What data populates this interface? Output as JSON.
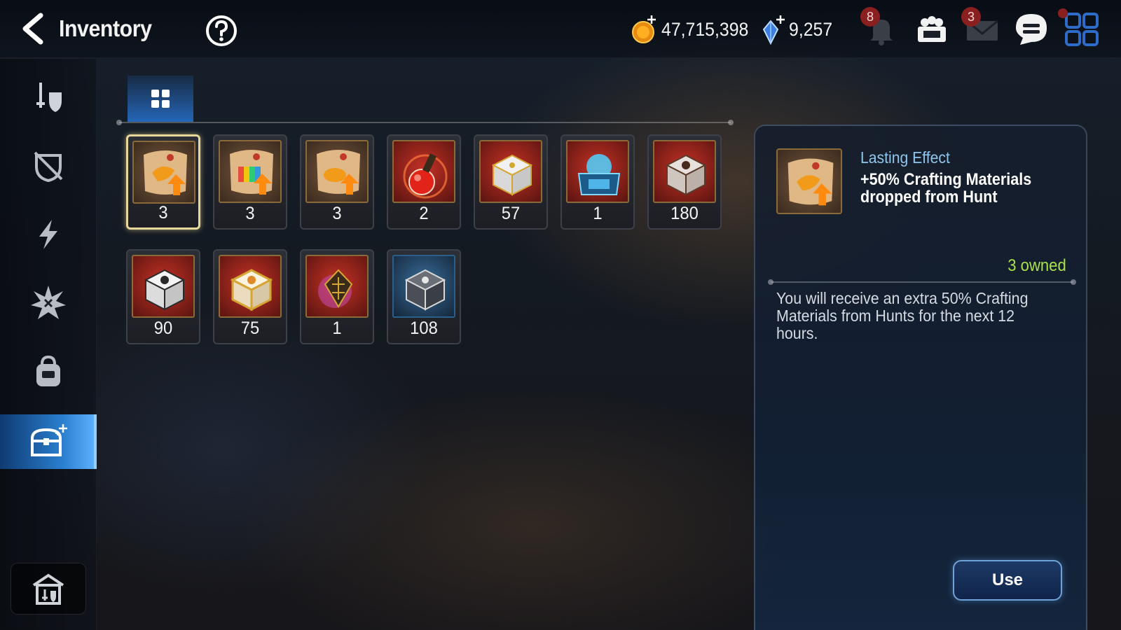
{
  "header": {
    "title": "Inventory",
    "back_icon": "chevron-left-icon",
    "help_icon": "question-circle-icon",
    "gold": "47,715,398",
    "crystals": "9,257",
    "notifications_badge": "8",
    "mail_badge": "3"
  },
  "sidebar": {
    "items": [
      {
        "name": "equipment",
        "icon": "sword-shield-icon"
      },
      {
        "name": "disabled-equipment",
        "icon": "crossed-shield-icon"
      },
      {
        "name": "artifacts",
        "icon": "lightning-icon"
      },
      {
        "name": "catalysts",
        "icon": "burst-icon"
      },
      {
        "name": "materials",
        "icon": "bag-icon"
      },
      {
        "name": "consumables",
        "icon": "treasure-chest-icon",
        "active": true
      }
    ],
    "bottom_icon": "storage-house-icon"
  },
  "filter_tab": {
    "icon": "grid-four-icon"
  },
  "items": [
    {
      "name": "scroll-dragon",
      "qty": "3",
      "selected": true
    },
    {
      "name": "scroll-rainbow",
      "qty": "3"
    },
    {
      "name": "scroll-bear",
      "qty": "3"
    },
    {
      "name": "red-potion",
      "qty": "2"
    },
    {
      "name": "gold-chest",
      "qty": "57"
    },
    {
      "name": "blue-crystal-chest",
      "qty": "1"
    },
    {
      "name": "brown-chest",
      "qty": "180"
    },
    {
      "name": "silver-chest",
      "qty": "90"
    },
    {
      "name": "gold-white-chest",
      "qty": "75"
    },
    {
      "name": "lantern-orb",
      "qty": "1"
    },
    {
      "name": "dark-cube",
      "qty": "108"
    }
  ],
  "detail": {
    "category": "Lasting Effect",
    "name": "+50% Crafting Materials dropped from Hunt",
    "owned": "3 owned",
    "description": "You will receive an extra 50% Crafting Materials from Hunts for the next 12 hours.",
    "use_label": "Use"
  },
  "colors": {
    "accent_blue": "#2a7fcf",
    "owned_green": "#a8e04a",
    "category_blue": "#8fc6ee",
    "badge_red": "#8a1f1f",
    "selected_border": "#e8d79a"
  }
}
